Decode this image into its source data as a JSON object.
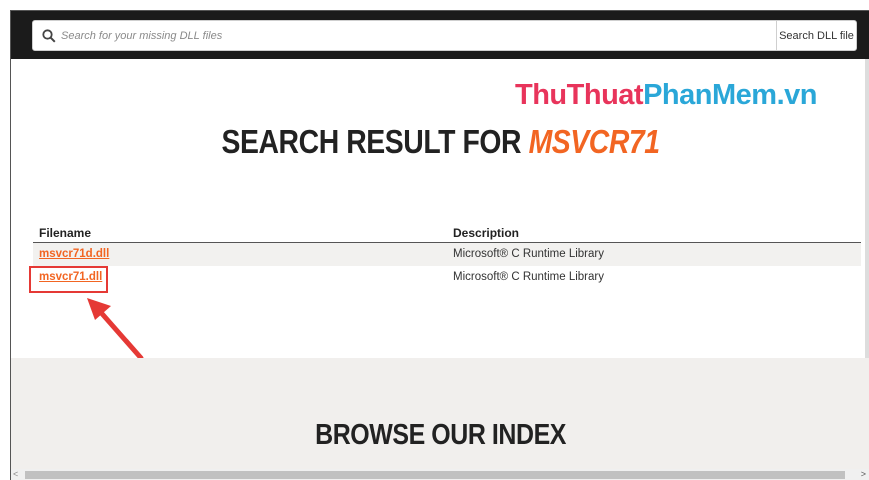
{
  "search": {
    "placeholder": "Search for your missing DLL files",
    "button_label": "Search DLL file"
  },
  "watermark": {
    "part1": "ThuThuat",
    "part2": "PhanMem",
    "part3": ".vn"
  },
  "heading": {
    "prefix": "SEARCH RESULT FOR ",
    "term": "MSVCR71"
  },
  "table": {
    "columns": [
      "Filename",
      "Description"
    ],
    "rows": [
      {
        "filename": "msvcr71d.dll",
        "description": "Microsoft® C Runtime Library"
      },
      {
        "filename": "msvcr71.dll",
        "description": "Microsoft® C Runtime Library"
      }
    ]
  },
  "browse": {
    "heading": "BROWSE OUR INDEX"
  },
  "scrollbar": {
    "left_arrow": "<",
    "right_arrow": ">"
  },
  "colors": {
    "accent": "#f26522",
    "topbar": "#1b1b1b",
    "annotation": "#e53935"
  }
}
